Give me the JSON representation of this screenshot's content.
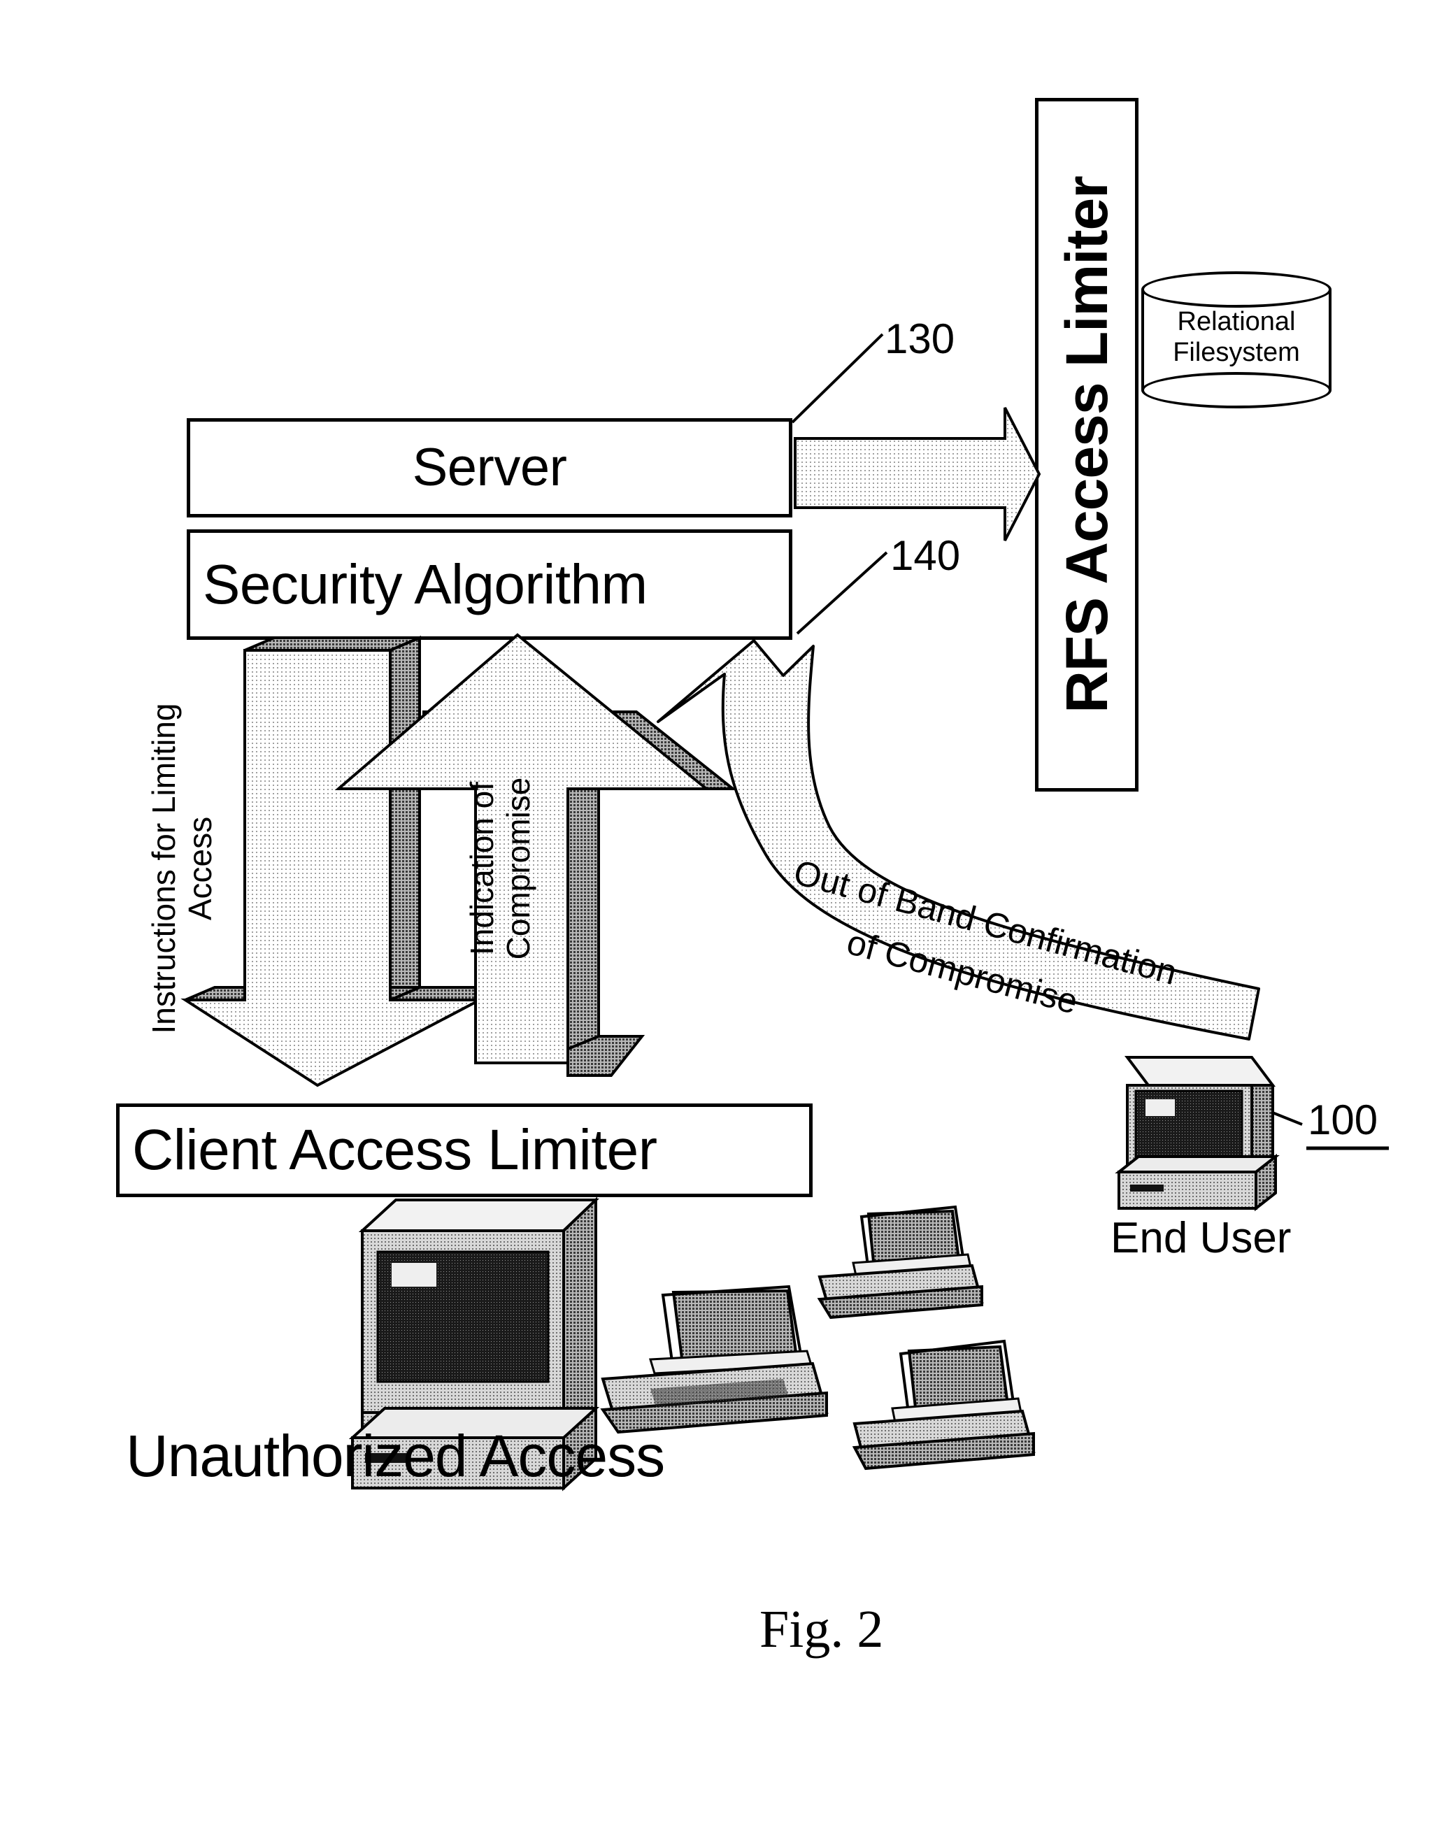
{
  "figure": {
    "label": "Fig. 2",
    "blocks": {
      "server": "Server",
      "security_algorithm": "Security Algorithm",
      "rfs_access_limiter": "RFS Access Limiter",
      "relational_filesystem_line1": "Relational",
      "relational_filesystem_line2": "Filesystem",
      "client_access_limiter": "Client Access Limiter"
    },
    "arrows": {
      "instructions_line1": "Instructions for Limiting",
      "instructions_line2": "Access",
      "indication_line1": "Indication of",
      "indication_line2": "Compromise",
      "out_of_band_line1": "Out of Band Confirmation",
      "out_of_band_line2": "of Compromise"
    },
    "captions": {
      "unauthorized_access": "Unauthorized Access",
      "end_user": "End User"
    },
    "reference_numerals": {
      "end_user": "100",
      "server": "130",
      "security_algorithm": "140"
    },
    "colors": {
      "ink": "#000000",
      "paper": "#ffffff",
      "arrow_fill_light": "#e8e8e8",
      "arrow_fill_shadow": "#9a9a9a",
      "device_fill": "#cfcfcf",
      "screen_fill": "#4a4a4a"
    }
  }
}
